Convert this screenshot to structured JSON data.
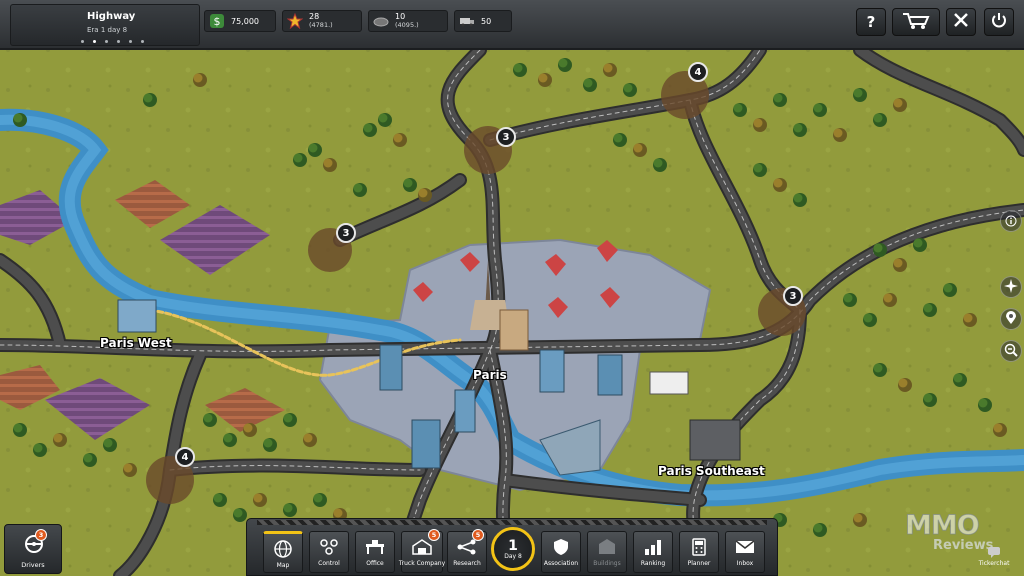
{
  "company": {
    "name": "Highway",
    "era": "Era 1 day 8"
  },
  "resources": {
    "money": "75,000",
    "stars": "28",
    "stars_sub": "(4781.)",
    "reputation": "10",
    "reputation_sub": "(4095.)",
    "trucks": "50"
  },
  "toolbar": {
    "help_label": "?"
  },
  "cities": {
    "paris_west": "Paris West",
    "paris": "Paris",
    "paris_southeast": "Paris Southeast"
  },
  "sites": [
    {
      "name": "site-top-right",
      "count": "4"
    },
    {
      "name": "site-top-center",
      "count": "3"
    },
    {
      "name": "site-left",
      "count": "3"
    },
    {
      "name": "site-right",
      "count": "3"
    },
    {
      "name": "site-bottom-left",
      "count": "4"
    }
  ],
  "bottom_nav": {
    "drivers": {
      "label": "Drivers",
      "badge": "3"
    },
    "map": {
      "label": "Map"
    },
    "control": {
      "label": "Control"
    },
    "office": {
      "label": "Office"
    },
    "truck_company": {
      "label": "Truck Company",
      "badge": "5"
    },
    "research": {
      "label": "Research",
      "badge": "5"
    },
    "day": {
      "number": "1",
      "label": "Day 8"
    },
    "association": {
      "label": "Association"
    },
    "buildings": {
      "label": "Buildings"
    },
    "ranking": {
      "label": "Ranking"
    },
    "planner": {
      "label": "Planner"
    },
    "inbox": {
      "label": "Inbox"
    },
    "tickerchat": {
      "label": "Tickerchat"
    }
  },
  "watermark": {
    "line1": "MMO",
    "line2": "Reviews"
  },
  "colors": {
    "grass": "#8f9a3a",
    "river": "#3f8fc6",
    "road": "#4a4a4a",
    "city": "#9aa3b5",
    "accent": "#f3c316"
  }
}
